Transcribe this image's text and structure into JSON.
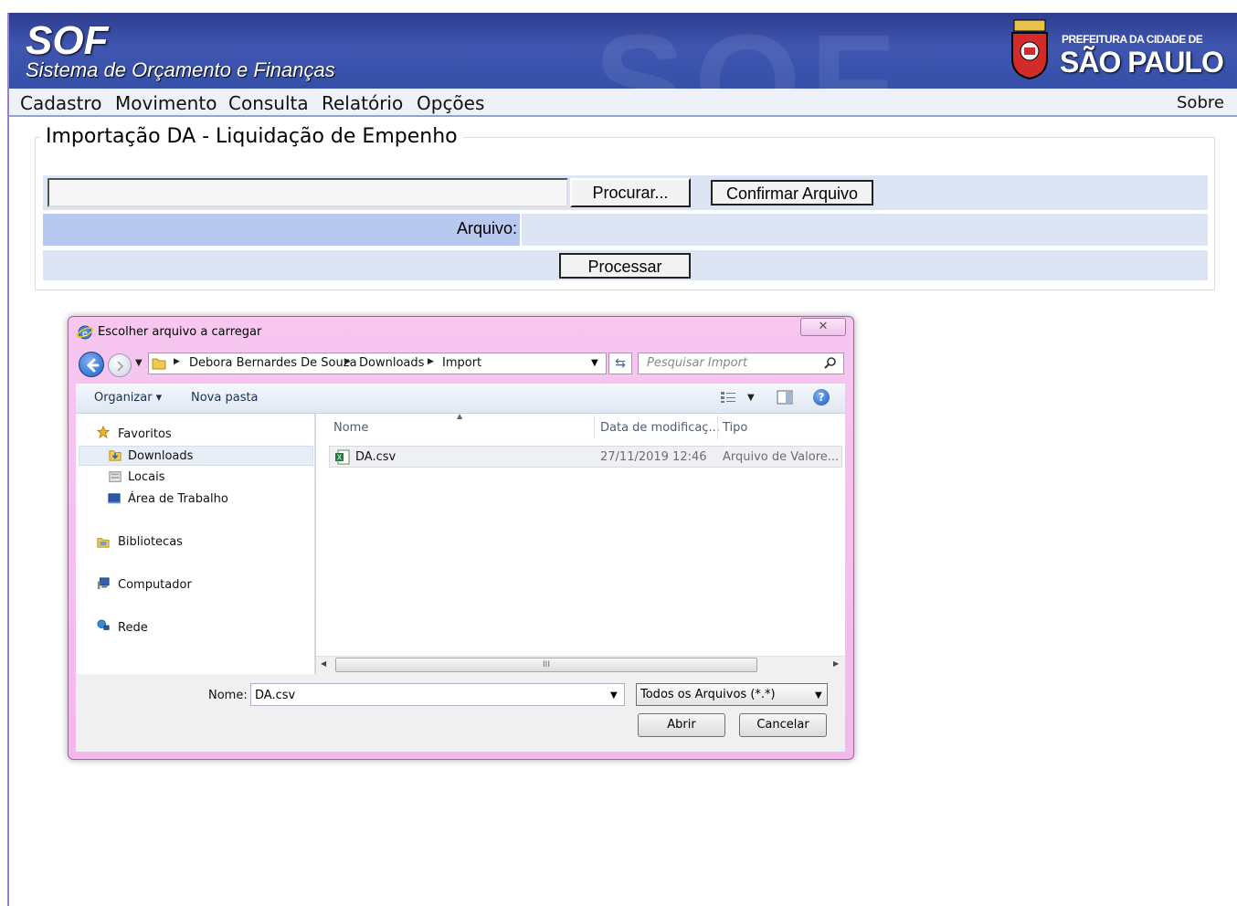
{
  "header": {
    "logo": "SOF",
    "subtitle": "Sistema de Orçamento e Finanças",
    "watermark": "SOF",
    "city_line1": "PREFEITURA DA CIDADE DE",
    "city_line2": "SÃO PAULO"
  },
  "menu": {
    "items": [
      "Cadastro",
      "Movimento",
      "Consulta",
      "Relatório",
      "Opções"
    ],
    "about": "Sobre"
  },
  "form": {
    "legend": "Importação DA - Liquidação de Empenho",
    "browse_button": "Procurar...",
    "file_input_value": "",
    "confirm_button": "Confirmar Arquivo",
    "file_label": "Arquivo:",
    "process_button": "Processar"
  },
  "dialog": {
    "title": "Escolher arquivo a carregar",
    "close_symbol": "✕",
    "breadcrumb": [
      "Debora Bernardes De Souza",
      "Downloads",
      "Import"
    ],
    "search_placeholder": "Pesquisar Import",
    "toolbar": {
      "organize": "Organizar ▾",
      "new_folder": "Nova pasta",
      "help": "?"
    },
    "nav": {
      "favorites": "Favoritos",
      "downloads": "Downloads",
      "locais": "Locais",
      "desktop": "Área de Trabalho",
      "libraries": "Bibliotecas",
      "computer": "Computador",
      "network": "Rede"
    },
    "columns": {
      "name": "Nome",
      "date": "Data de modificaç...",
      "type": "Tipo"
    },
    "files": [
      {
        "name": "DA.csv",
        "date": "27/11/2019 12:46",
        "type": "Arquivo de Valore..."
      }
    ],
    "scroll_grip": "III",
    "name_label": "Nome:",
    "name_value": "DA.csv",
    "filter": "Todos os Arquivos (*.*)",
    "open_button": "Abrir",
    "cancel_button": "Cancelar"
  },
  "colors": {
    "banner": "#3f56b0",
    "dialog_frame": "#f3b8ec",
    "row_light": "#dde5f5",
    "row_dark": "#b9c8ee"
  }
}
